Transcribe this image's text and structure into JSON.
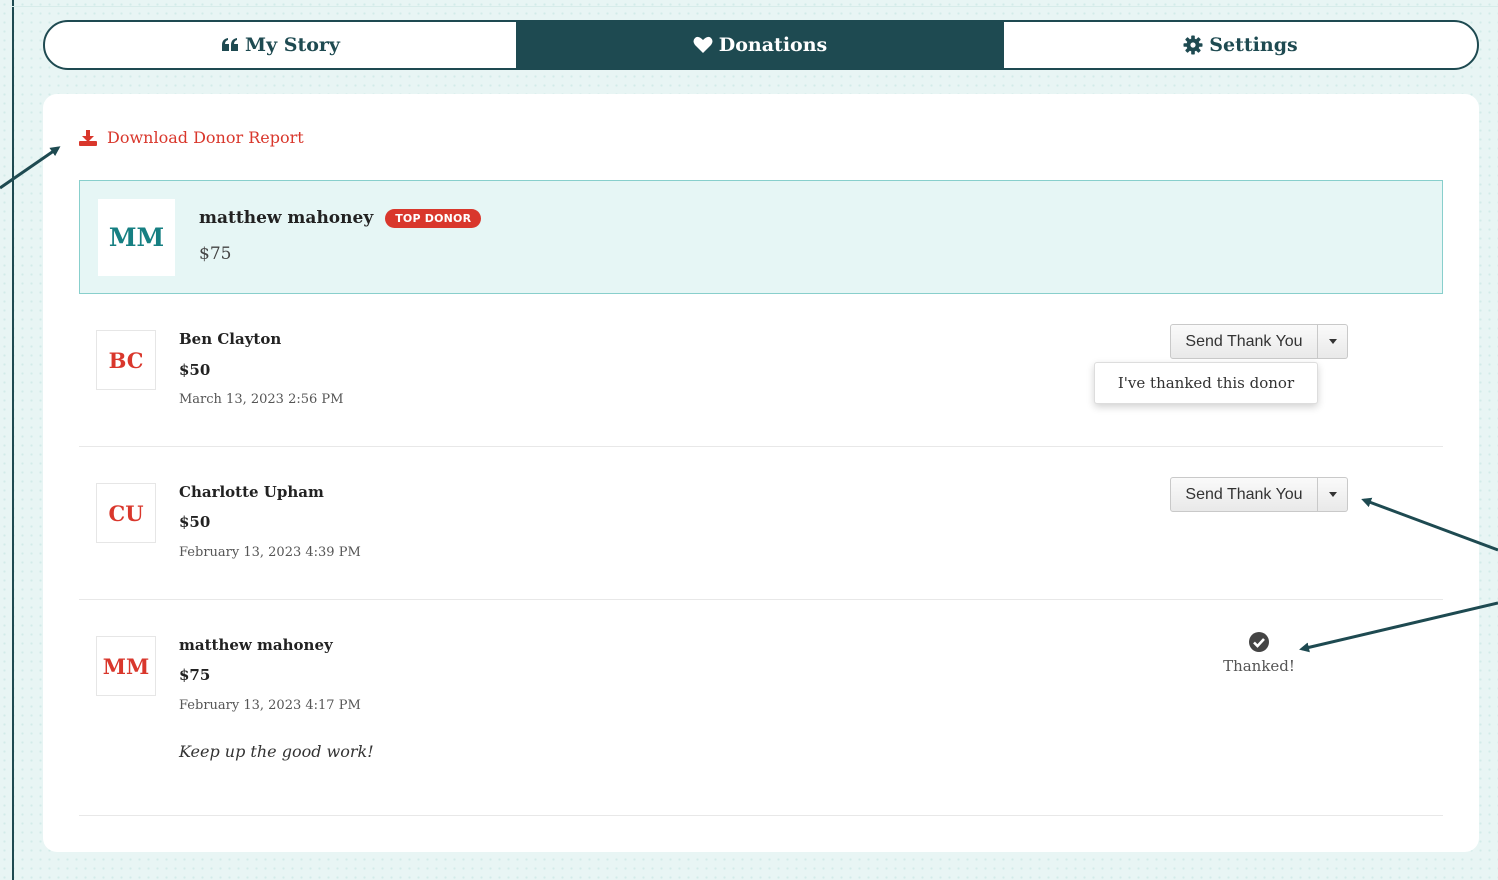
{
  "tabs": [
    {
      "label": "My Story",
      "icon": "quote-icon"
    },
    {
      "label": "Donations",
      "icon": "heart-icon",
      "active": true
    },
    {
      "label": "Settings",
      "icon": "gear-icon"
    }
  ],
  "download_link": "Download Donor Report",
  "top_donor": {
    "initials": "MM",
    "name": "matthew mahoney",
    "badge": "TOP DONOR",
    "amount": "$75"
  },
  "donations": [
    {
      "initials": "BC",
      "name": "Ben Clayton",
      "amount": "$50",
      "date": "March 13, 2023 2:56 PM",
      "action": "Send Thank You"
    },
    {
      "initials": "CU",
      "name": "Charlotte Upham",
      "amount": "$50",
      "date": "February 13, 2023 4:39 PM",
      "action": "Send Thank You"
    },
    {
      "initials": "MM",
      "name": "matthew mahoney",
      "amount": "$75",
      "date": "February 13, 2023 4:17 PM",
      "note": "Keep up the good work!",
      "status": "Thanked!"
    }
  ],
  "dropdown_menu": {
    "item": "I've thanked this donor"
  },
  "colors": {
    "primary": "#1e4a51",
    "accent": "#d9372c",
    "teal": "#167f82",
    "highlight_bg": "#e6f6f5"
  }
}
